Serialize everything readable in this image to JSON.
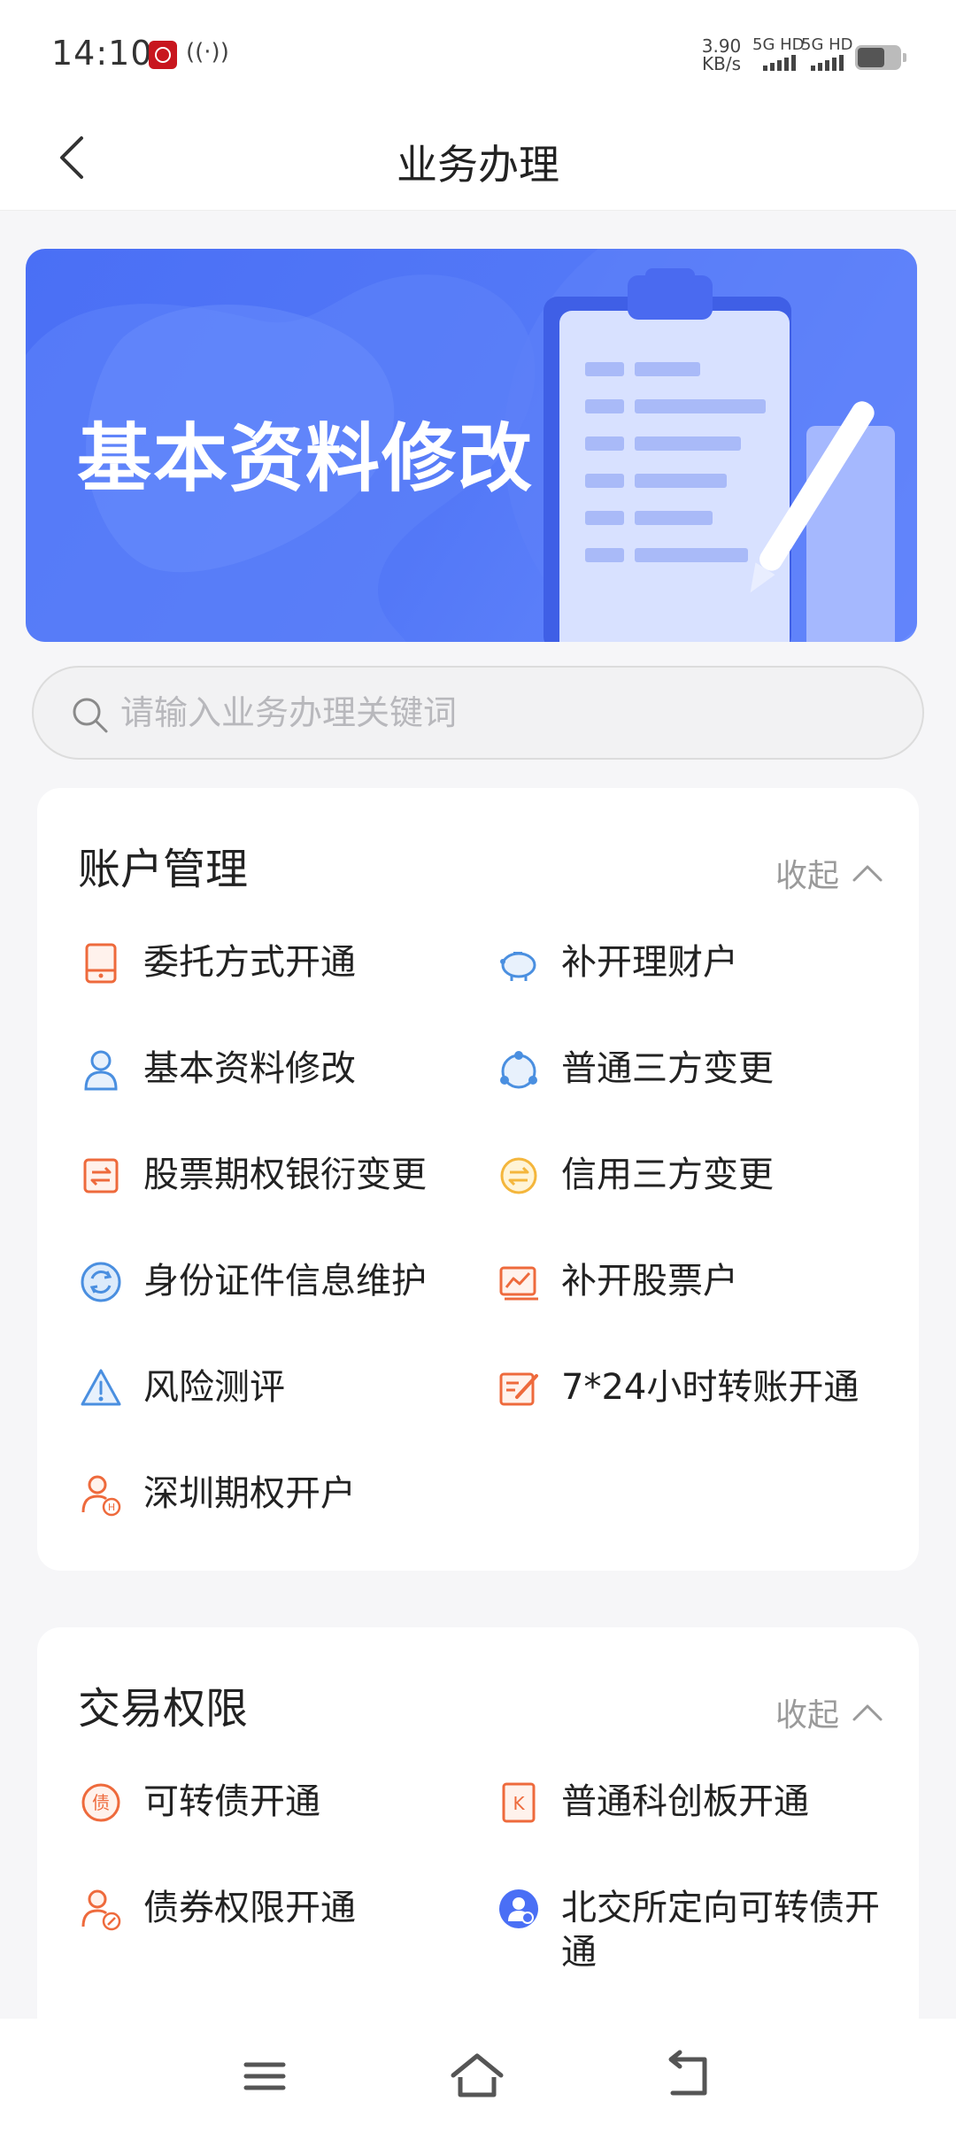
{
  "status_bar": {
    "time": "14:10",
    "speed_value": "3.90",
    "speed_unit": "KB/s",
    "net1": "5G HD",
    "net2": "5G HD"
  },
  "header": {
    "title": "业务办理"
  },
  "banner": {
    "title": "基本资料修改"
  },
  "search": {
    "placeholder": "请输入业务办理关键词"
  },
  "sections": [
    {
      "title": "账户管理",
      "collapse_label": "收起",
      "items": [
        {
          "label": "委托方式开通",
          "icon": "tablet-icon"
        },
        {
          "label": "补开理财户",
          "icon": "piggy-bank-icon"
        },
        {
          "label": "基本资料修改",
          "icon": "user-icon"
        },
        {
          "label": "普通三方变更",
          "icon": "triangle-nodes-icon"
        },
        {
          "label": "股票期权银衍变更",
          "icon": "transfer-icon"
        },
        {
          "label": "信用三方变更",
          "icon": "exchange-circle-icon"
        },
        {
          "label": "身份证件信息维护",
          "icon": "refresh-circle-icon"
        },
        {
          "label": "补开股票户",
          "icon": "stock-chart-icon"
        },
        {
          "label": "风险测评",
          "icon": "warning-icon"
        },
        {
          "label": "7*24小时转账开通",
          "icon": "edit-form-icon"
        },
        {
          "label": "深圳期权开户",
          "icon": "user-option-icon"
        }
      ]
    },
    {
      "title": "交易权限",
      "collapse_label": "收起",
      "items": [
        {
          "label": "可转债开通",
          "icon": "bond-convert-icon"
        },
        {
          "label": "普通科创板开通",
          "icon": "k-board-icon"
        },
        {
          "label": "债券权限开通",
          "icon": "user-bond-icon"
        },
        {
          "label": "北交所定向可转债开通",
          "icon": "user-badge-icon"
        }
      ]
    }
  ],
  "colors": {
    "accent_blue": "#4a6ff5",
    "icon_orange": "#ee6a3c",
    "icon_blue": "#4a8fe0"
  }
}
